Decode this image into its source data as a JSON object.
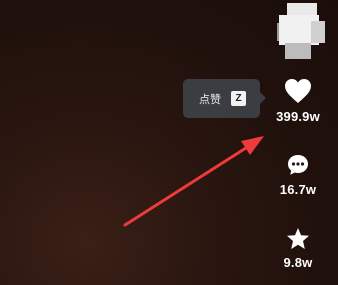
{
  "author": {
    "avatar_icon": "author-avatar"
  },
  "shortcut_tooltip": {
    "label": "点赞",
    "key": "Z"
  },
  "actions": {
    "like": {
      "icon": "heart-icon",
      "count": "399.9w"
    },
    "comment": {
      "icon": "comment-bubble-icon",
      "count": "16.7w"
    },
    "favorite": {
      "icon": "star-icon",
      "count": "9.8w"
    }
  },
  "annotation": {
    "icon": "red-arrow",
    "color": "#ee3a3a"
  }
}
